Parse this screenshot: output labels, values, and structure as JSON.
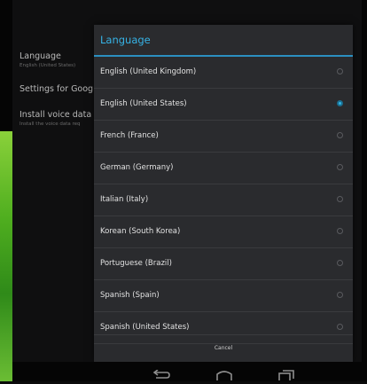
{
  "settings": {
    "items": [
      {
        "title": "Language",
        "subtitle": "English (United States)"
      },
      {
        "title": "Settings for Google",
        "subtitle": ""
      },
      {
        "title": "Install voice data",
        "subtitle": "Install the voice data req"
      }
    ]
  },
  "dialog": {
    "title": "Language",
    "accent_color": "#33b5e5",
    "options": [
      {
        "label": "English (United Kingdom)",
        "selected": false
      },
      {
        "label": "English (United States)",
        "selected": true
      },
      {
        "label": "French (France)",
        "selected": false
      },
      {
        "label": "German (Germany)",
        "selected": false
      },
      {
        "label": "Italian (Italy)",
        "selected": false
      },
      {
        "label": "Korean (South Korea)",
        "selected": false
      },
      {
        "label": "Portuguese (Brazil)",
        "selected": false
      },
      {
        "label": "Spanish (Spain)",
        "selected": false
      },
      {
        "label": "Spanish (United States)",
        "selected": false
      }
    ],
    "cancel_label": "Cancel"
  },
  "navbar": {
    "icons": [
      "back-icon",
      "home-icon",
      "recent-apps-icon"
    ]
  }
}
